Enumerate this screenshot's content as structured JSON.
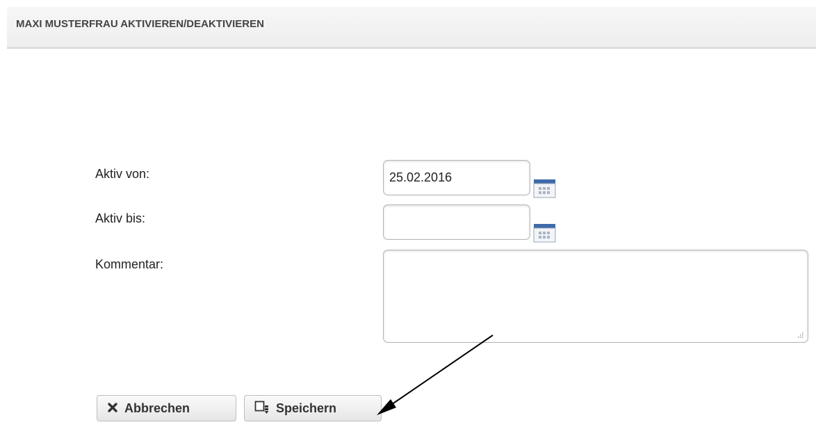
{
  "dialog": {
    "title": "MAXI MUSTERFRAU AKTIVIEREN/DEAKTIVIEREN"
  },
  "form": {
    "active_from": {
      "label": "Aktiv von:",
      "value": "25.02.2016"
    },
    "active_until": {
      "label": "Aktiv bis:",
      "value": ""
    },
    "comment": {
      "label": "Kommentar:",
      "value": ""
    }
  },
  "buttons": {
    "cancel_label": "Abbrechen",
    "save_label": "Speichern"
  },
  "icons": {
    "cancel": "close-icon",
    "save": "save-icon",
    "calendar": "calendar-icon"
  },
  "colors": {
    "calendar_header": "#3e6aa8",
    "header_border": "#d4d4d4"
  }
}
